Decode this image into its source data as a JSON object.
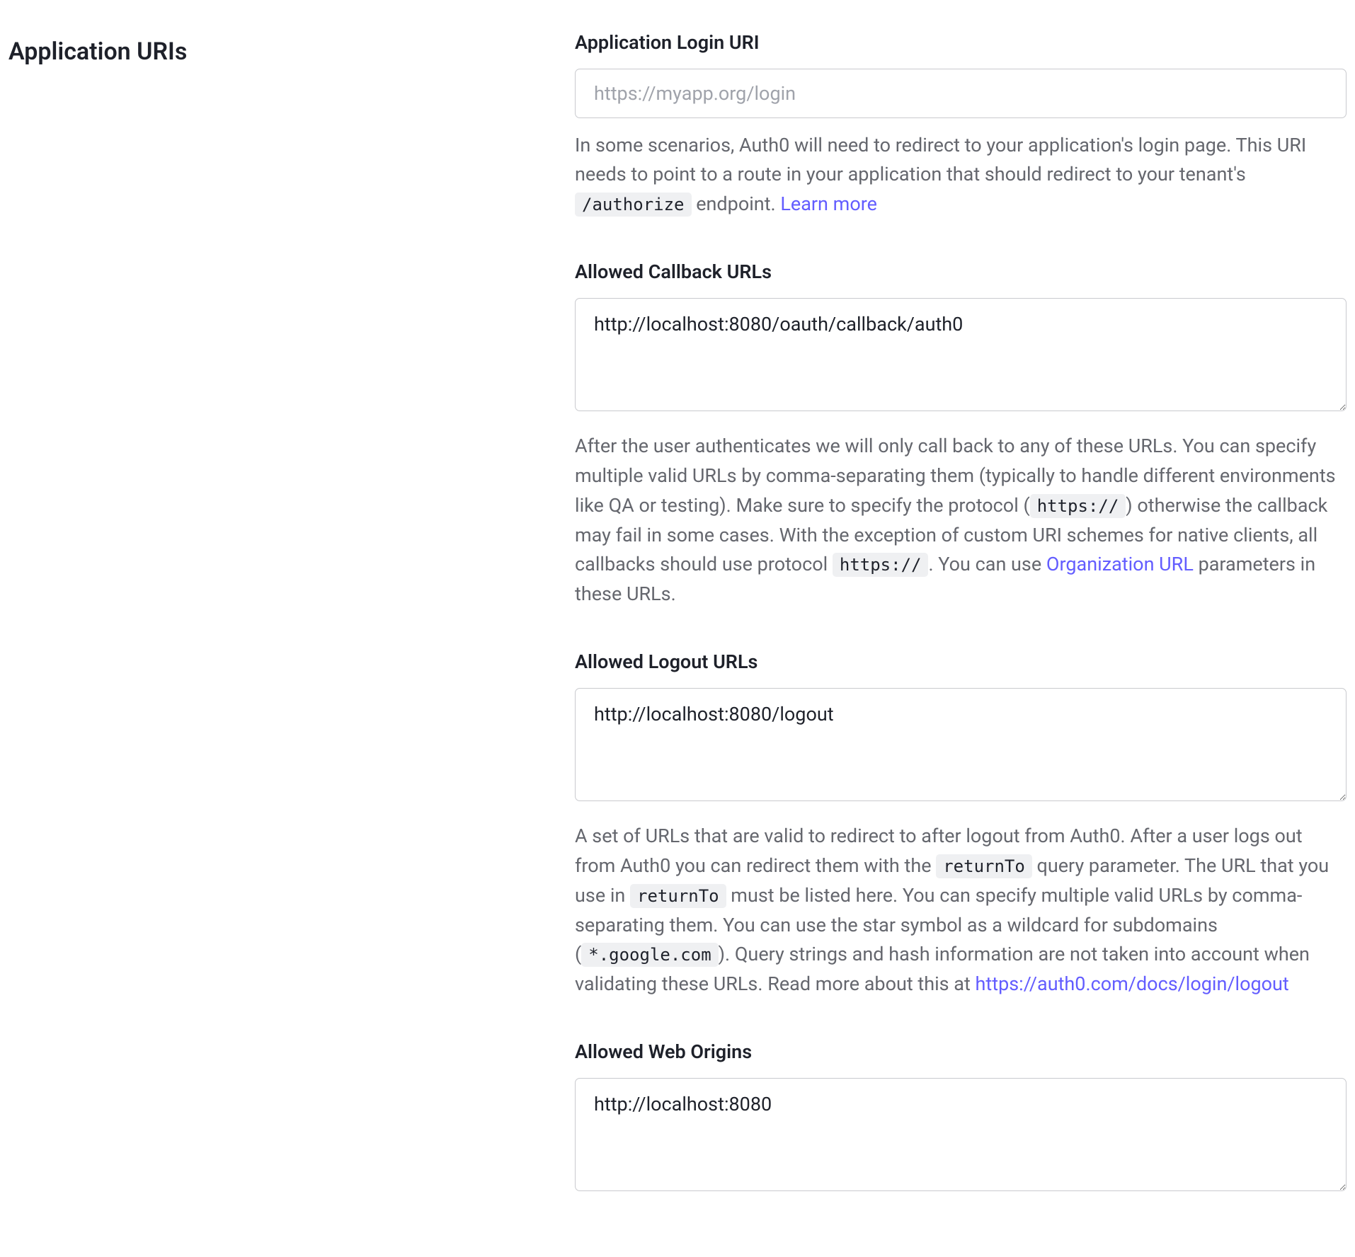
{
  "section": {
    "title": "Application URIs"
  },
  "fields": {
    "loginUri": {
      "label": "Application Login URI",
      "placeholder": "https://myapp.org/login",
      "value": "",
      "help_pre": "In some scenarios, Auth0 will need to redirect to your application's login page. This URI needs to point to a route in your application that should redirect to your tenant's ",
      "help_code": "/authorize",
      "help_post": " endpoint. ",
      "learn_more": "Learn more"
    },
    "callbackUrls": {
      "label": "Allowed Callback URLs",
      "value": "http://localhost:8080/oauth/callback/auth0",
      "help_p1": "After the user authenticates we will only call back to any of these URLs. You can specify multiple valid URLs by comma-separating them (typically to handle different environments like QA or testing). Make sure to specify the protocol (",
      "code1": "https://",
      "help_p2": ") otherwise the callback may fail in some cases. With the exception of custom URI schemes for native clients, all callbacks should use protocol ",
      "code2": "https://",
      "help_p3": ". You can use ",
      "link_text": "Organization URL",
      "help_p4": " parameters in these URLs."
    },
    "logoutUrls": {
      "label": "Allowed Logout URLs",
      "value": "http://localhost:8080/logout",
      "help_p1": "A set of URLs that are valid to redirect to after logout from Auth0. After a user logs out from Auth0 you can redirect them with the ",
      "code1": "returnTo",
      "help_p2": " query parameter. The URL that you use in ",
      "code2": "returnTo",
      "help_p3": " must be listed here. You can specify multiple valid URLs by comma-separating them. You can use the star symbol as a wildcard for subdomains (",
      "code3": "*.google.com",
      "help_p4": "). Query strings and hash information are not taken into account when validating these URLs. Read more about this at ",
      "link_text": "https://auth0.com/docs/login/logout"
    },
    "webOrigins": {
      "label": "Allowed Web Origins",
      "value": "http://localhost:8080"
    }
  }
}
